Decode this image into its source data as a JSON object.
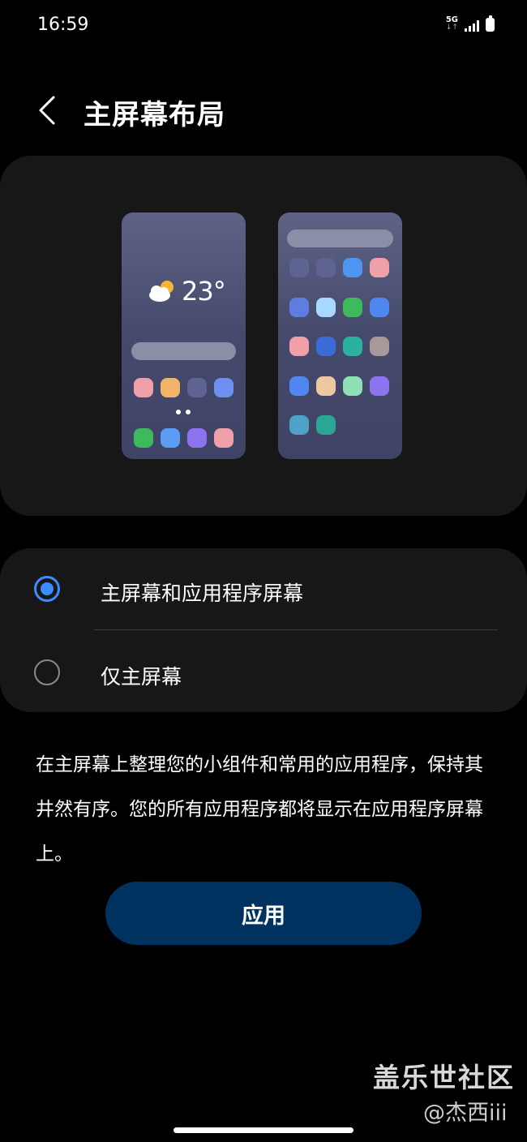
{
  "status_bar": {
    "time": "16:59",
    "network": "5G",
    "network_arrows": "↓↑"
  },
  "header": {
    "back_icon": "chevron-left-icon",
    "title": "主屏幕布局"
  },
  "preview": {
    "weather_icon": "partly-cloudy-icon",
    "temperature": "23°",
    "home_screen_icon_colors": [
      "#f0a0a8",
      "#f3b46a",
      "#5e6392",
      "#6c8ff0",
      "#3dba5c",
      "#5b9cf5",
      "#8d73f0",
      "#f0a0a8"
    ],
    "apps_screen_icon_colors": [
      "#5e6392",
      "#5e6392",
      "#4c96f2",
      "#f0a0a8",
      "#5d7de0",
      "#a8d8ff",
      "#3dba5c",
      "#4f86f0",
      "#f0a0a8",
      "#3a6cd6",
      "#29b39e",
      "#a8989a",
      "#4f86f0",
      "#ecc8a0",
      "#8fdfb4",
      "#8d73f0",
      "#4ea2c8",
      "#2aa596"
    ]
  },
  "options": [
    {
      "label": "主屏幕和应用程序屏幕",
      "selected": true
    },
    {
      "label": "仅主屏幕",
      "selected": false
    }
  ],
  "description": "在主屏幕上整理您的小组件和常用的应用程序，保持其井然有序。您的所有应用程序都将显示在应用程序屏幕上。",
  "apply_button": {
    "label": "应用"
  },
  "watermark": {
    "title": "盖乐世社区",
    "user": "@杰西iii"
  },
  "colors": {
    "accent": "#3b8cff",
    "button_bg": "#00325f",
    "card_bg": "#171717"
  }
}
